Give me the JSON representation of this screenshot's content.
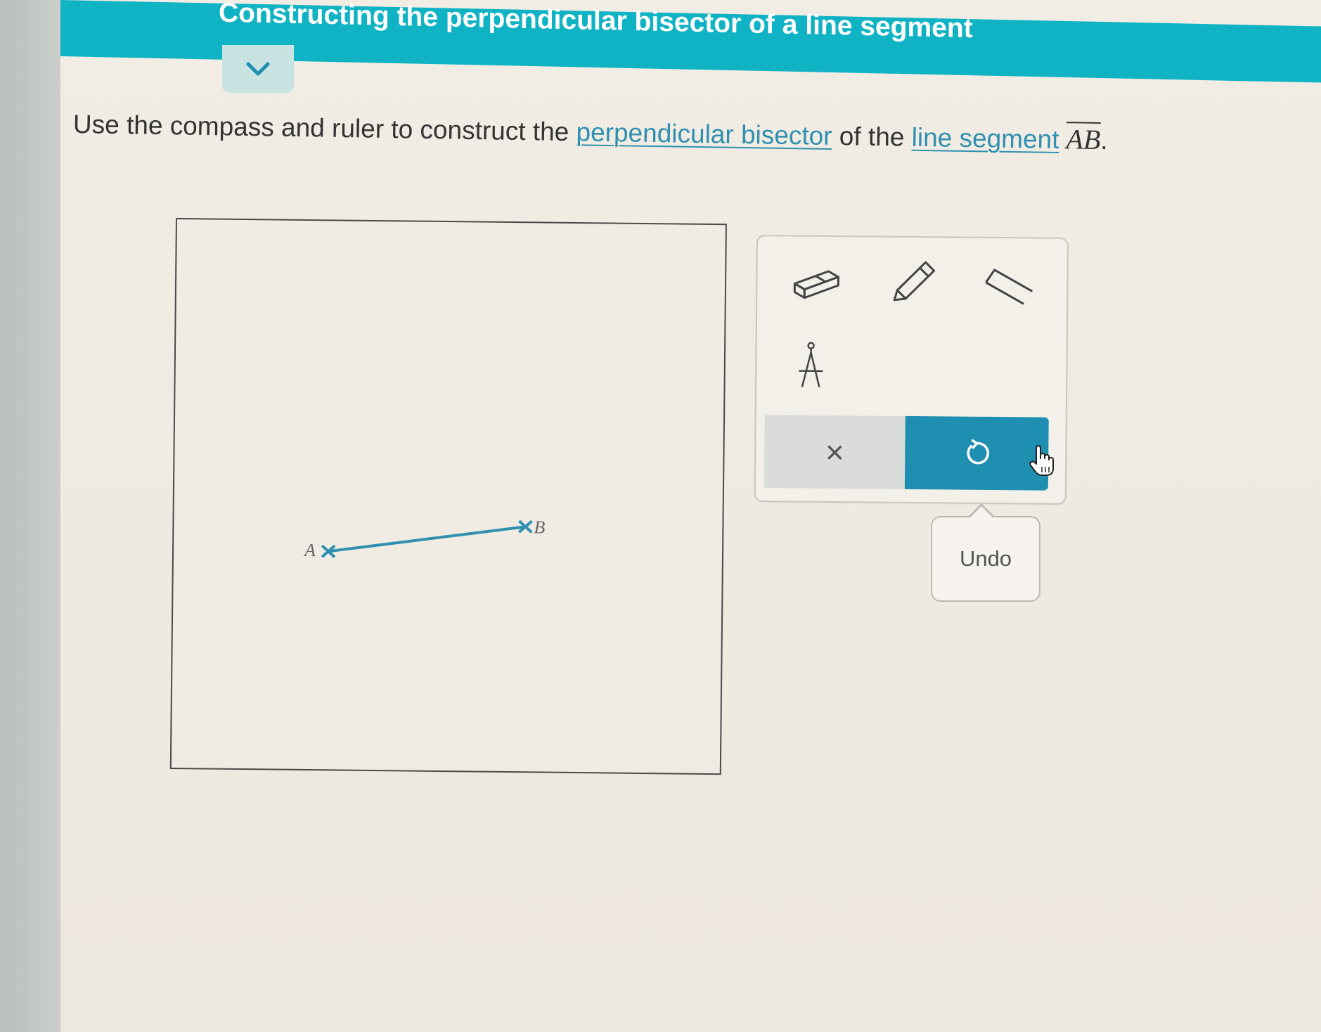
{
  "header": {
    "title": "Constructing the perpendicular bisector of a line segment"
  },
  "instructions": {
    "prefix": "Use the compass and ruler to construct the ",
    "link1": "perpendicular bisector",
    "middle": " of the ",
    "link2": "line segment",
    "segment": "AB",
    "suffix": "."
  },
  "canvas": {
    "points": [
      {
        "label": "A"
      },
      {
        "label": "B"
      }
    ],
    "segment_color": "#2f8fb0"
  },
  "toolbox": {
    "tools": [
      {
        "icon": "eraser-icon"
      },
      {
        "icon": "pencil-icon"
      },
      {
        "icon": "ruler-icon"
      },
      {
        "icon": "compass-icon"
      }
    ],
    "clear_label": "×",
    "undo_icon": "undo-icon",
    "accent": "#1e8fb1"
  },
  "tooltip": {
    "text": "Undo"
  }
}
